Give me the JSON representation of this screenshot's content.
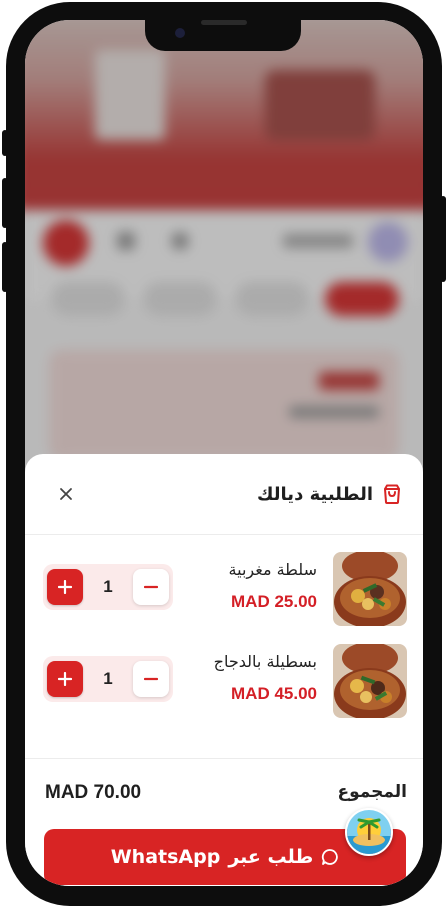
{
  "cart": {
    "title": "الطلبية ديالك",
    "items": [
      {
        "name": "سلطة مغربية",
        "price": "MAD 25.00",
        "qty": "1"
      },
      {
        "name": "بسطيلة بالدجاج",
        "price": "MAD 45.00",
        "qty": "1"
      }
    ],
    "total_label": "المجموع",
    "total_value": "MAD 70.00",
    "order_button": {
      "label": "طلب عبر",
      "brand": "WhatsApp"
    }
  },
  "icons": {
    "close": "close-icon",
    "bag": "shopping-bag-icon",
    "plus": "plus-icon",
    "minus": "minus-icon",
    "chat": "chat-bubble-icon"
  },
  "colors": {
    "accent": "#d82424",
    "price": "#d41f26",
    "stepper_bg": "#fbeaea"
  }
}
